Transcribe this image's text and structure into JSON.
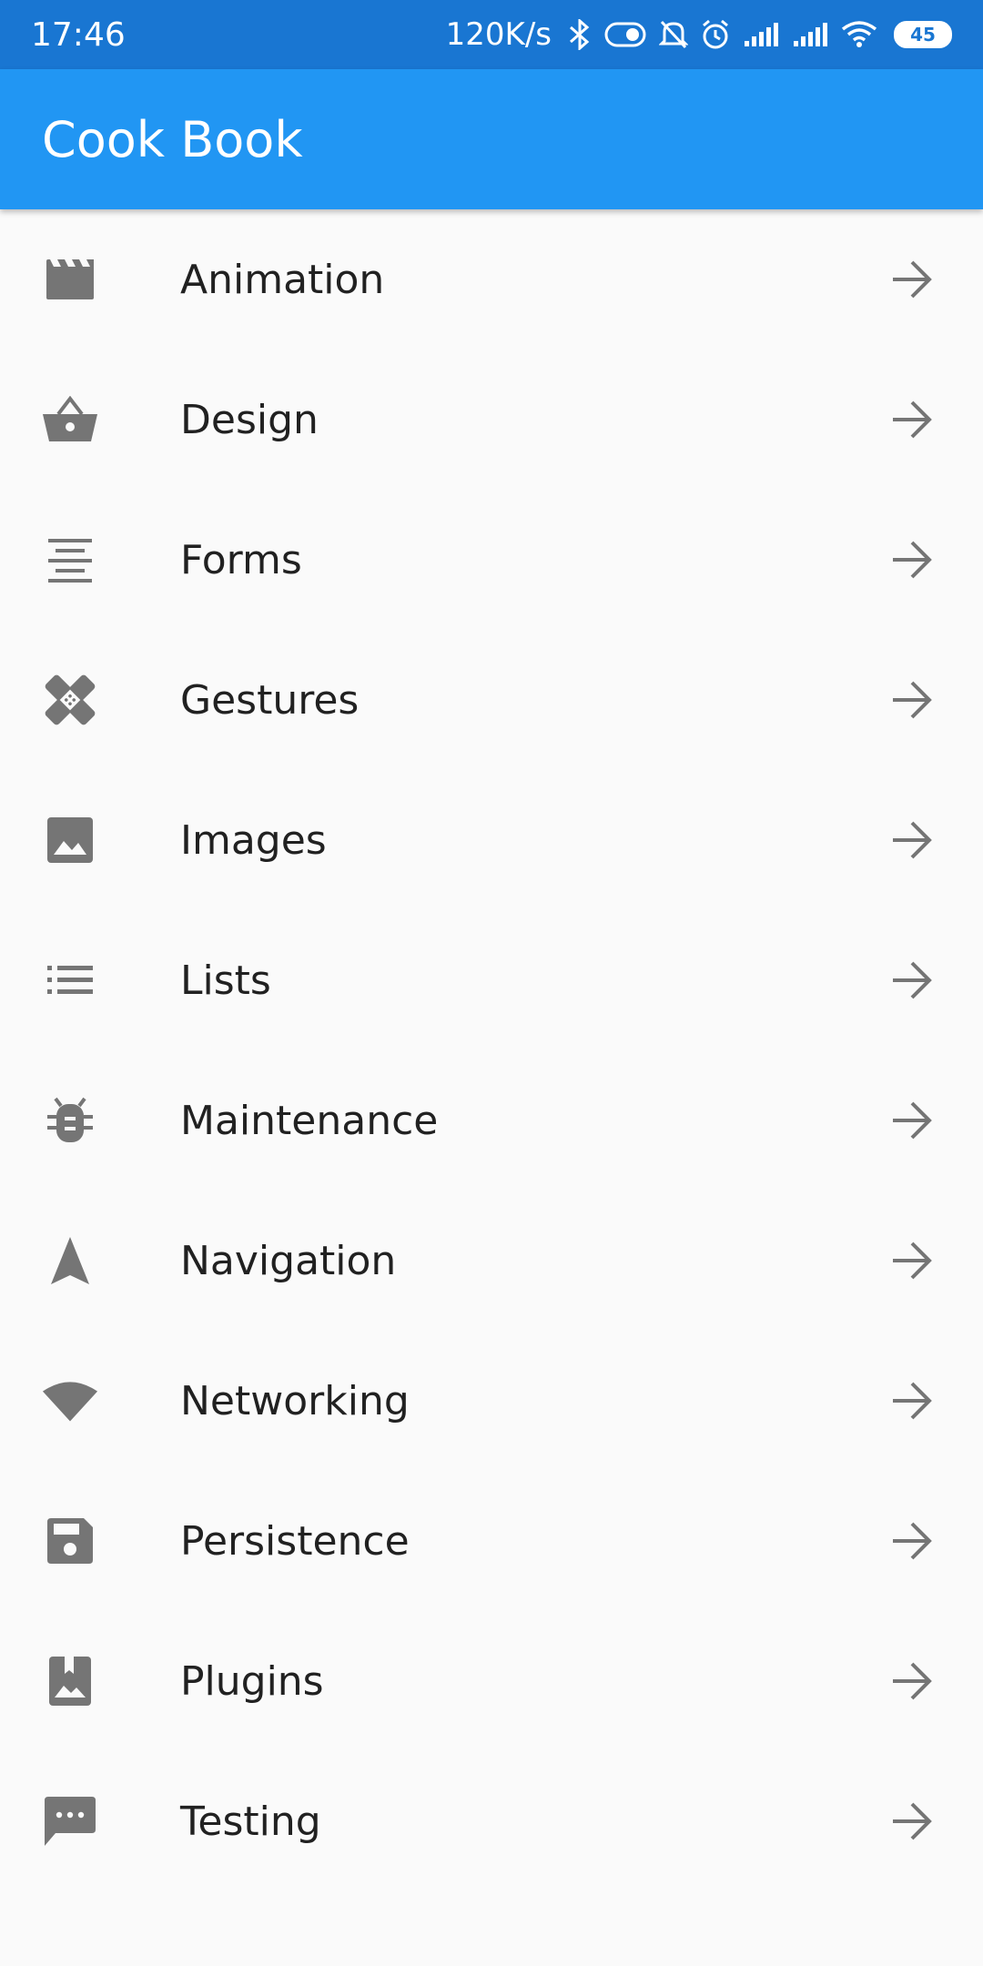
{
  "status_bar": {
    "time": "17:46",
    "network_speed": "120K/s",
    "battery_level": "45",
    "icons": [
      "bluetooth-icon",
      "toggle-icon",
      "notifications-off-icon",
      "alarm-icon",
      "signal-icon",
      "signal-icon",
      "wifi-icon",
      "battery-icon"
    ]
  },
  "app_bar": {
    "title": "Cook Book",
    "color": "#2196F3"
  },
  "list": {
    "items": [
      {
        "label": "Animation",
        "icon": "movie-icon"
      },
      {
        "label": "Design",
        "icon": "basket-icon"
      },
      {
        "label": "Forms",
        "icon": "format-align-center-icon"
      },
      {
        "label": "Gestures",
        "icon": "bandage-icon"
      },
      {
        "label": "Images",
        "icon": "image-icon"
      },
      {
        "label": "Lists",
        "icon": "list-icon"
      },
      {
        "label": "Maintenance",
        "icon": "bug-icon"
      },
      {
        "label": "Navigation",
        "icon": "navigation-icon"
      },
      {
        "label": "Networking",
        "icon": "wifi-icon"
      },
      {
        "label": "Persistence",
        "icon": "save-icon"
      },
      {
        "label": "Plugins",
        "icon": "photo-album-icon"
      },
      {
        "label": "Testing",
        "icon": "message-icon"
      }
    ],
    "trailing_icon": "arrow-forward-icon"
  }
}
